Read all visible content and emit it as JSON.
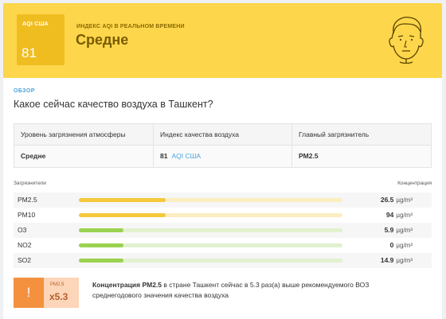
{
  "hero": {
    "aqi_label": "AQI США",
    "aqi_value": "81",
    "realtime_label": "ИНДЕКС AQI В РЕАЛЬНОМ ВРЕМЕНИ",
    "status": "Средне",
    "color": "#fdd64b",
    "face_icon": "face-neutral-icon"
  },
  "overview": {
    "tag": "ОБЗОР",
    "question": "Какое сейчас качество воздуха в Ташкент?"
  },
  "summary": {
    "headers": [
      "Уровень загрязнения атмосферы",
      "Индекс качества воздуха",
      "Главный загрязнитель"
    ],
    "level": "Средне",
    "index_value": "81",
    "index_unit": "AQI США",
    "main_pollutant": "PM2.5"
  },
  "pollutants": {
    "header_left": "Загрязнители",
    "header_right": "Концентрация",
    "items": [
      {
        "name": "PM2.5",
        "value": "26.5",
        "unit": "µg/m³",
        "fill": 0.33,
        "color": "#f5c93b",
        "track": "#fbeec2"
      },
      {
        "name": "PM10",
        "value": "94",
        "unit": "µg/m³",
        "fill": 0.33,
        "color": "#f5c93b",
        "track": "#fbeec2"
      },
      {
        "name": "O3",
        "value": "5.9",
        "unit": "µg/m³",
        "fill": 0.17,
        "color": "#9ad24f",
        "track": "#e2f1d0"
      },
      {
        "name": "NO2",
        "value": "0",
        "unit": "µg/m³",
        "fill": 0.17,
        "color": "#9ad24f",
        "track": "#e2f1d0"
      },
      {
        "name": "SO2",
        "value": "14.9",
        "unit": "µg/m³",
        "fill": 0.17,
        "color": "#9ad24f",
        "track": "#e2f1d0"
      }
    ]
  },
  "ratio": {
    "icon": "!",
    "label": "PM2.5",
    "value": "x5.3",
    "text_bold": "Концентрация PM2.5",
    "text_rest": "в стране Ташкент сейчас в 5.3 раз(а) выше рекомендуемого ВОЗ среднегодового значения качества воздуха"
  }
}
